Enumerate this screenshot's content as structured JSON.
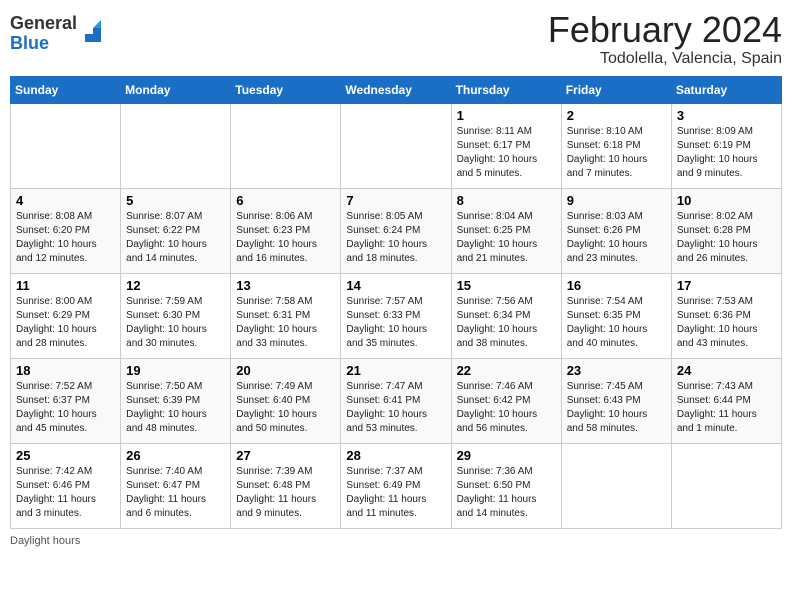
{
  "app": {
    "logo_general": "General",
    "logo_blue": "Blue",
    "month_year": "February 2024",
    "location": "Todolella, Valencia, Spain"
  },
  "calendar": {
    "headers": [
      "Sunday",
      "Monday",
      "Tuesday",
      "Wednesday",
      "Thursday",
      "Friday",
      "Saturday"
    ],
    "weeks": [
      [
        {
          "day": "",
          "info": ""
        },
        {
          "day": "",
          "info": ""
        },
        {
          "day": "",
          "info": ""
        },
        {
          "day": "",
          "info": ""
        },
        {
          "day": "1",
          "info": "Sunrise: 8:11 AM\nSunset: 6:17 PM\nDaylight: 10 hours\nand 5 minutes."
        },
        {
          "day": "2",
          "info": "Sunrise: 8:10 AM\nSunset: 6:18 PM\nDaylight: 10 hours\nand 7 minutes."
        },
        {
          "day": "3",
          "info": "Sunrise: 8:09 AM\nSunset: 6:19 PM\nDaylight: 10 hours\nand 9 minutes."
        }
      ],
      [
        {
          "day": "4",
          "info": "Sunrise: 8:08 AM\nSunset: 6:20 PM\nDaylight: 10 hours\nand 12 minutes."
        },
        {
          "day": "5",
          "info": "Sunrise: 8:07 AM\nSunset: 6:22 PM\nDaylight: 10 hours\nand 14 minutes."
        },
        {
          "day": "6",
          "info": "Sunrise: 8:06 AM\nSunset: 6:23 PM\nDaylight: 10 hours\nand 16 minutes."
        },
        {
          "day": "7",
          "info": "Sunrise: 8:05 AM\nSunset: 6:24 PM\nDaylight: 10 hours\nand 18 minutes."
        },
        {
          "day": "8",
          "info": "Sunrise: 8:04 AM\nSunset: 6:25 PM\nDaylight: 10 hours\nand 21 minutes."
        },
        {
          "day": "9",
          "info": "Sunrise: 8:03 AM\nSunset: 6:26 PM\nDaylight: 10 hours\nand 23 minutes."
        },
        {
          "day": "10",
          "info": "Sunrise: 8:02 AM\nSunset: 6:28 PM\nDaylight: 10 hours\nand 26 minutes."
        }
      ],
      [
        {
          "day": "11",
          "info": "Sunrise: 8:00 AM\nSunset: 6:29 PM\nDaylight: 10 hours\nand 28 minutes."
        },
        {
          "day": "12",
          "info": "Sunrise: 7:59 AM\nSunset: 6:30 PM\nDaylight: 10 hours\nand 30 minutes."
        },
        {
          "day": "13",
          "info": "Sunrise: 7:58 AM\nSunset: 6:31 PM\nDaylight: 10 hours\nand 33 minutes."
        },
        {
          "day": "14",
          "info": "Sunrise: 7:57 AM\nSunset: 6:33 PM\nDaylight: 10 hours\nand 35 minutes."
        },
        {
          "day": "15",
          "info": "Sunrise: 7:56 AM\nSunset: 6:34 PM\nDaylight: 10 hours\nand 38 minutes."
        },
        {
          "day": "16",
          "info": "Sunrise: 7:54 AM\nSunset: 6:35 PM\nDaylight: 10 hours\nand 40 minutes."
        },
        {
          "day": "17",
          "info": "Sunrise: 7:53 AM\nSunset: 6:36 PM\nDaylight: 10 hours\nand 43 minutes."
        }
      ],
      [
        {
          "day": "18",
          "info": "Sunrise: 7:52 AM\nSunset: 6:37 PM\nDaylight: 10 hours\nand 45 minutes."
        },
        {
          "day": "19",
          "info": "Sunrise: 7:50 AM\nSunset: 6:39 PM\nDaylight: 10 hours\nand 48 minutes."
        },
        {
          "day": "20",
          "info": "Sunrise: 7:49 AM\nSunset: 6:40 PM\nDaylight: 10 hours\nand 50 minutes."
        },
        {
          "day": "21",
          "info": "Sunrise: 7:47 AM\nSunset: 6:41 PM\nDaylight: 10 hours\nand 53 minutes."
        },
        {
          "day": "22",
          "info": "Sunrise: 7:46 AM\nSunset: 6:42 PM\nDaylight: 10 hours\nand 56 minutes."
        },
        {
          "day": "23",
          "info": "Sunrise: 7:45 AM\nSunset: 6:43 PM\nDaylight: 10 hours\nand 58 minutes."
        },
        {
          "day": "24",
          "info": "Sunrise: 7:43 AM\nSunset: 6:44 PM\nDaylight: 11 hours\nand 1 minute."
        }
      ],
      [
        {
          "day": "25",
          "info": "Sunrise: 7:42 AM\nSunset: 6:46 PM\nDaylight: 11 hours\nand 3 minutes."
        },
        {
          "day": "26",
          "info": "Sunrise: 7:40 AM\nSunset: 6:47 PM\nDaylight: 11 hours\nand 6 minutes."
        },
        {
          "day": "27",
          "info": "Sunrise: 7:39 AM\nSunset: 6:48 PM\nDaylight: 11 hours\nand 9 minutes."
        },
        {
          "day": "28",
          "info": "Sunrise: 7:37 AM\nSunset: 6:49 PM\nDaylight: 11 hours\nand 11 minutes."
        },
        {
          "day": "29",
          "info": "Sunrise: 7:36 AM\nSunset: 6:50 PM\nDaylight: 11 hours\nand 14 minutes."
        },
        {
          "day": "",
          "info": ""
        },
        {
          "day": "",
          "info": ""
        }
      ]
    ]
  },
  "footer": {
    "text": "Daylight hours"
  }
}
